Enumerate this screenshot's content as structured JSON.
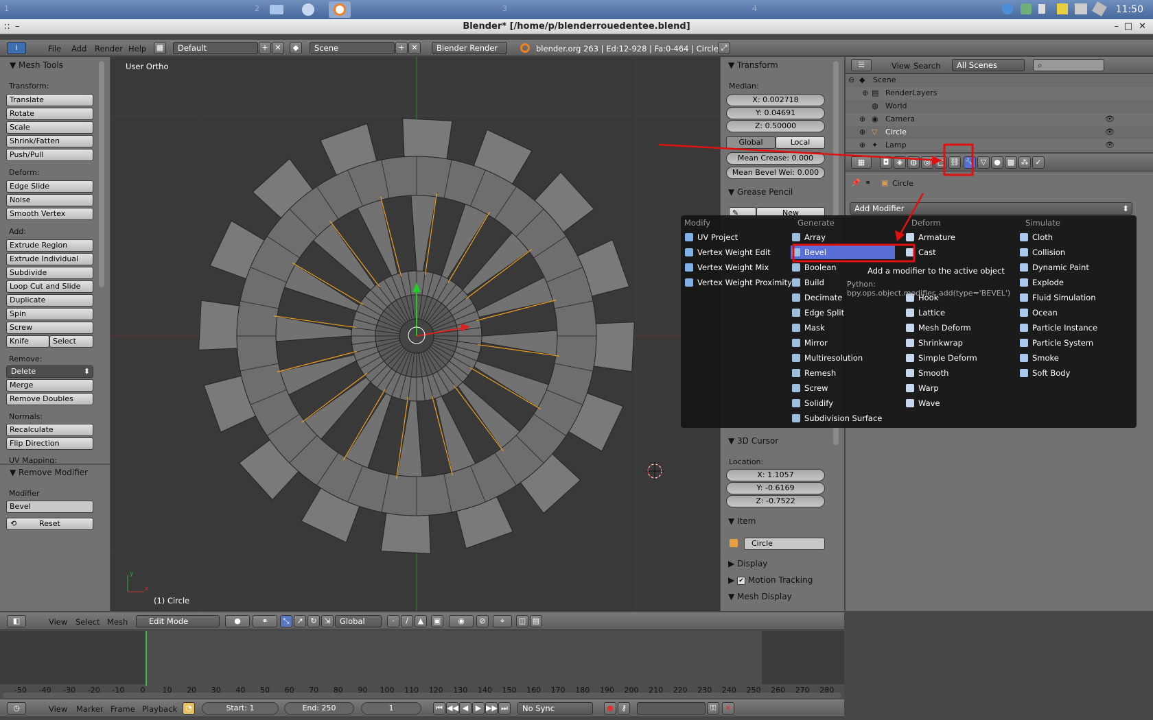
{
  "taskbar": {
    "workspaces": [
      "1",
      "2",
      "3",
      "4"
    ],
    "clock": "11:50"
  },
  "window": {
    "title": "Blender* [/home/p/blenderrouedentee.blend]"
  },
  "info_header": {
    "menus": [
      "File",
      "Add",
      "Render",
      "Help"
    ],
    "layout": "Default",
    "scene": "Scene",
    "engine": "Blender Render",
    "stats": "blender.org 263 | Ed:12-928 | Fa:0-464 | Circle"
  },
  "tool_shelf": {
    "title": "Mesh Tools",
    "transform_label": "Transform:",
    "transform": [
      "Translate",
      "Rotate",
      "Scale",
      "Shrink/Fatten",
      "Push/Pull"
    ],
    "deform_label": "Deform:",
    "deform": [
      "Edge Slide",
      "Noise",
      "Smooth Vertex"
    ],
    "add_label": "Add:",
    "add": [
      "Extrude Region",
      "Extrude Individual",
      "Subdivide",
      "Loop Cut and Slide",
      "Duplicate",
      "Spin",
      "Screw"
    ],
    "knife": "Knife",
    "select": "Select",
    "remove_label": "Remove:",
    "delete": "Delete",
    "remove": [
      "Merge",
      "Remove Doubles"
    ],
    "normals_label": "Normals:",
    "normals": [
      "Recalculate",
      "Flip Direction"
    ],
    "uv_label": "UV Mapping:",
    "op_title": "Remove Modifier",
    "modifier_label": "Modifier",
    "modifier_value": "Bevel",
    "reset": "Reset"
  },
  "viewport": {
    "view_name": "User Ortho",
    "object_label": "(1) Circle"
  },
  "properties_region": {
    "transform_title": "Transform",
    "median_label": "Median:",
    "x": "X: 0.002718",
    "y": "Y: 0.04691",
    "z": "Z: 0.50000",
    "global": "Global",
    "local": "Local",
    "mean_crease": "Mean Crease: 0.000",
    "mean_bevel": "Mean Bevel Wei: 0.000",
    "grease_title": "Grease Pencil",
    "new": "New",
    "cursor_title": "3D Cursor",
    "location_label": "Location:",
    "cx": "X: 1.1057",
    "cy": "Y: -0.6169",
    "cz": "Z: -0.7522",
    "item_title": "Item",
    "item_name": "Circle",
    "display_title": "Display",
    "motion_title": "Motion Tracking",
    "mesh_display_title": "Mesh Display"
  },
  "view3d_header": {
    "menus": [
      "View",
      "Select",
      "Mesh"
    ],
    "mode": "Edit Mode",
    "orientation": "Global"
  },
  "outliner": {
    "menus": [
      "View",
      "Search"
    ],
    "filter": "All Scenes",
    "items": [
      "Scene",
      "RenderLayers",
      "World",
      "Camera",
      "Circle",
      "Lamp"
    ]
  },
  "properties": {
    "breadcrumb": "Circle",
    "add_modifier": "Add Modifier"
  },
  "add_menu": {
    "headers": [
      "Modify",
      "Generate",
      "Deform",
      "Simulate"
    ],
    "modify": [
      "UV Project",
      "Vertex Weight Edit",
      "Vertex Weight Mix",
      "Vertex Weight Proximity"
    ],
    "generate": [
      "Array",
      "Bevel",
      "Boolean",
      "Build",
      "Decimate",
      "Edge Split",
      "Mask",
      "Mirror",
      "Multiresolution",
      "Remesh",
      "Screw",
      "Solidify",
      "Subdivision Surface"
    ],
    "deform": [
      "Armature",
      "Cast",
      "",
      "",
      "Hook",
      "Lattice",
      "Mesh Deform",
      "Shrinkwrap",
      "Simple Deform",
      "Smooth",
      "Warp",
      "Wave"
    ],
    "simulate": [
      "Cloth",
      "Collision",
      "Dynamic Paint",
      "Explode",
      "Fluid Simulation",
      "Ocean",
      "Particle Instance",
      "Particle System",
      "Smoke",
      "Soft Body"
    ],
    "tooltip": "Add a modifier to the active object",
    "tooltip_python": "Python: bpy.ops.object.modifier_add(type='BEVEL')"
  },
  "timeline": {
    "ticks": [
      "-50",
      "-40",
      "-30",
      "-20",
      "-10",
      "0",
      "10",
      "20",
      "30",
      "40",
      "50",
      "60",
      "70",
      "80",
      "90",
      "100",
      "110",
      "120",
      "130",
      "140",
      "150",
      "160",
      "170",
      "180",
      "190",
      "200",
      "210",
      "220",
      "230",
      "240",
      "250",
      "260",
      "270",
      "280"
    ],
    "menus": [
      "View",
      "Marker",
      "Frame",
      "Playback"
    ],
    "start": "Start: 1",
    "end": "End: 250",
    "current": "1",
    "sync": "No Sync"
  },
  "colors": {
    "highlight": "#5a6ed8",
    "annotation": "#e01010"
  }
}
